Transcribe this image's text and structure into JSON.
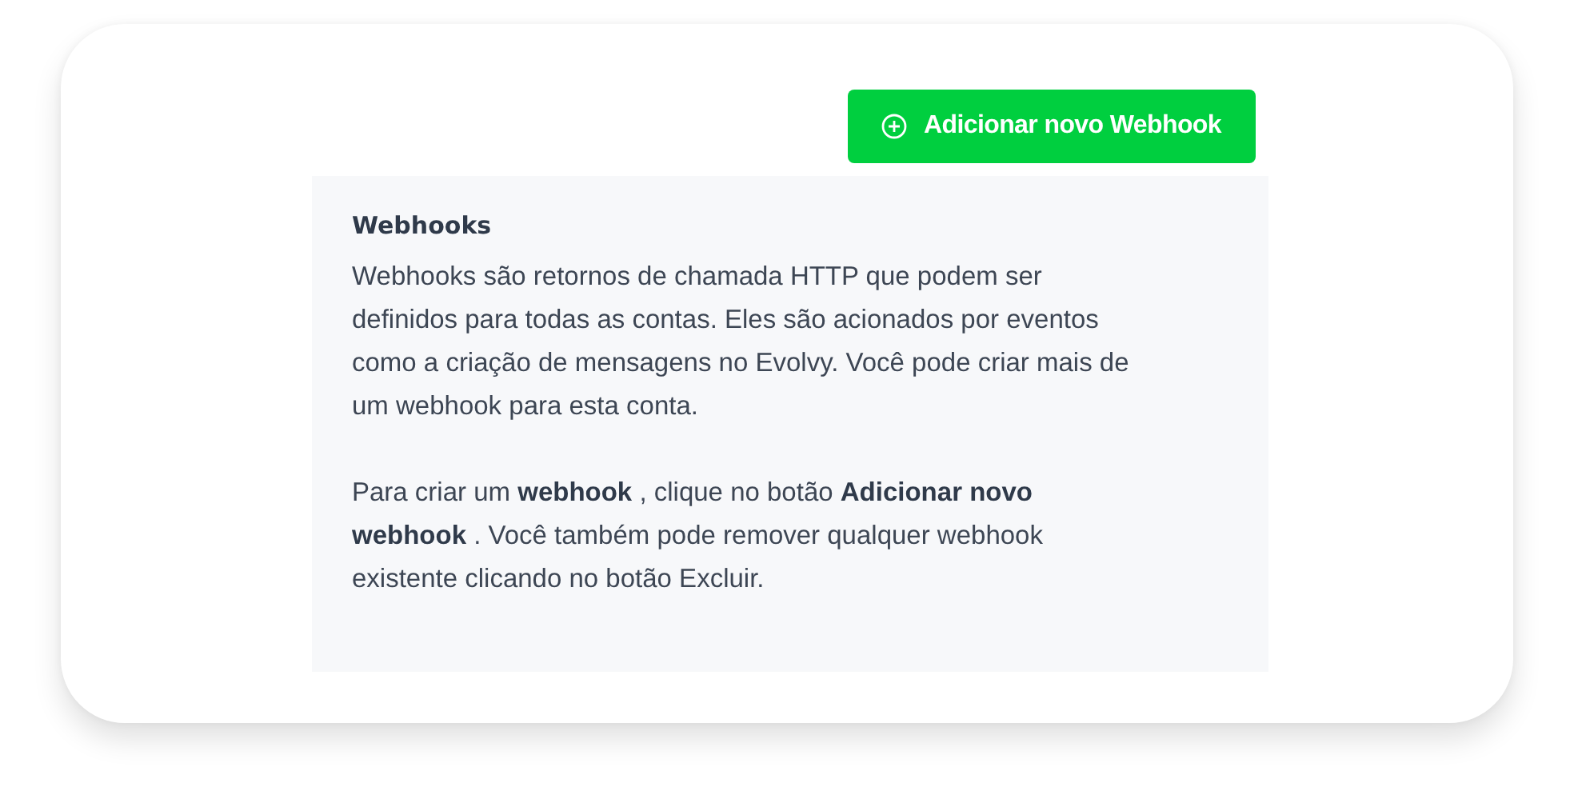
{
  "add_button": {
    "label": "Adicionar novo Webhook"
  },
  "info_panel": {
    "title": "Webhooks",
    "paragraphs": [
      "Webhooks são retornos de chamada HTTP que podem ser definidos para todas as contas. Eles são acionados por eventos como a criação de mensagens no Evolvy. Você pode criar mais de um webhook para esta conta.",
      "Para criar um **webhook** , clique no botão **Adicionar novo webhook** . Você também pode remover qualquer webhook existente clicando no botão Excluir."
    ]
  }
}
